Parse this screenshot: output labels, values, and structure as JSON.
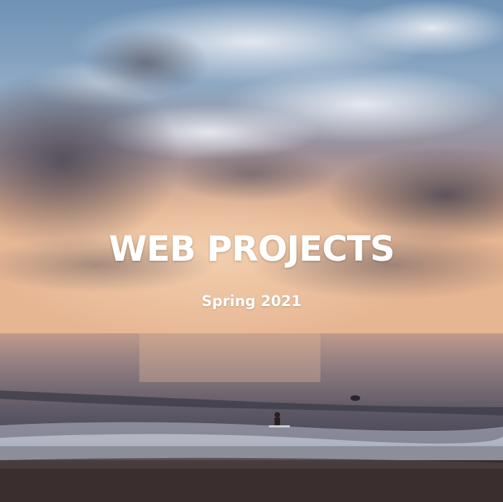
{
  "hero": {
    "title": "WEB PROJECTS",
    "subtitle": "Spring 2021"
  },
  "colors": {
    "text": "#ffffff",
    "sky_top": "#7fa3c4",
    "sky_glow": "#e8b48f",
    "sea": "#6d6670",
    "sand": "#3a2f2e"
  },
  "icons": {
    "background": "sunset-beach-photo"
  }
}
